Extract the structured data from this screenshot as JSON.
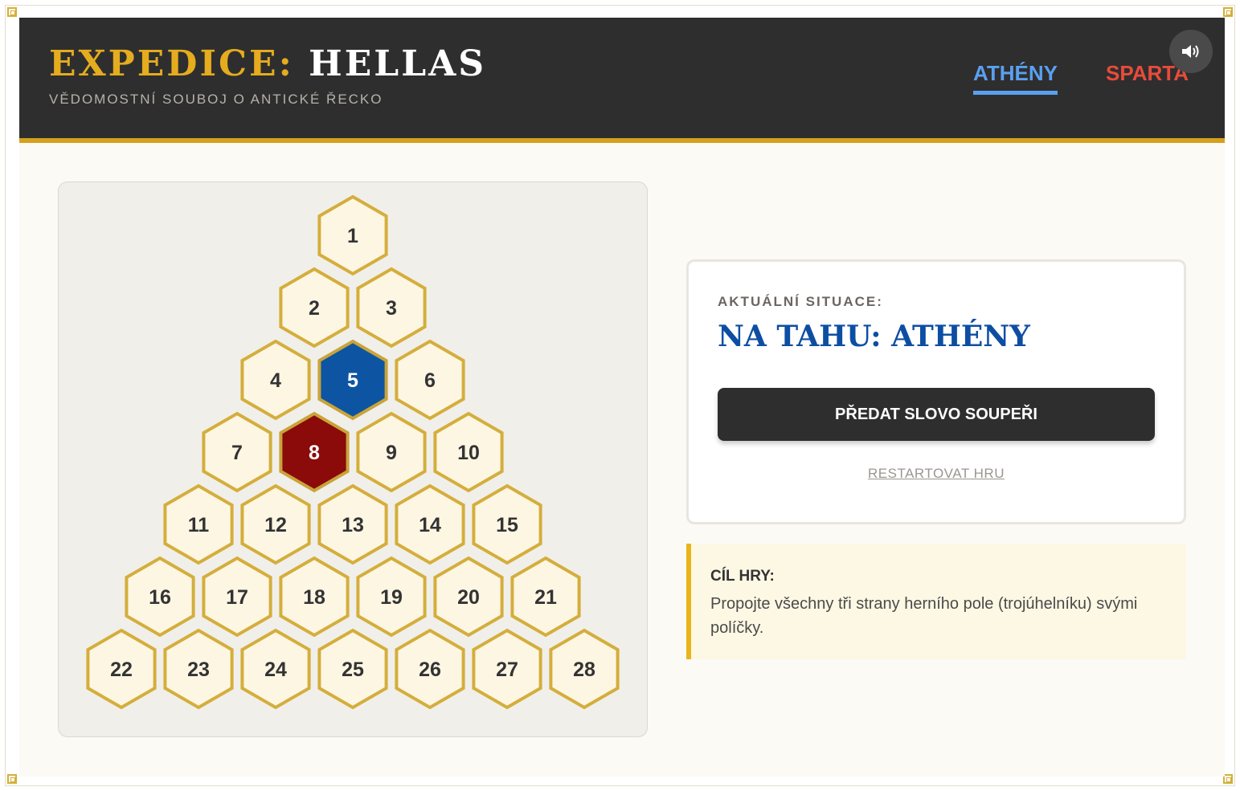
{
  "header": {
    "title_part1": "EXPEDICE:",
    "title_part2": "HELLAS",
    "subtitle": "VĚDOMOSTNÍ SOUBOJ O ANTICKÉ ŘECKO",
    "teams": [
      {
        "label": "ATHÉNY",
        "color": "#5aa0f0",
        "active": true
      },
      {
        "label": "SPARTA",
        "color": "#e84b3a",
        "active": false
      }
    ],
    "sound_icon": "speaker-icon"
  },
  "board": {
    "rows": 7,
    "cells": [
      {
        "n": "1",
        "owner": "none"
      },
      {
        "n": "2",
        "owner": "none"
      },
      {
        "n": "3",
        "owner": "none"
      },
      {
        "n": "4",
        "owner": "none"
      },
      {
        "n": "5",
        "owner": "athens"
      },
      {
        "n": "6",
        "owner": "none"
      },
      {
        "n": "7",
        "owner": "none"
      },
      {
        "n": "8",
        "owner": "sparta"
      },
      {
        "n": "9",
        "owner": "none"
      },
      {
        "n": "10",
        "owner": "none"
      },
      {
        "n": "11",
        "owner": "none"
      },
      {
        "n": "12",
        "owner": "none"
      },
      {
        "n": "13",
        "owner": "none"
      },
      {
        "n": "14",
        "owner": "none"
      },
      {
        "n": "15",
        "owner": "none"
      },
      {
        "n": "16",
        "owner": "none"
      },
      {
        "n": "17",
        "owner": "none"
      },
      {
        "n": "18",
        "owner": "none"
      },
      {
        "n": "19",
        "owner": "none"
      },
      {
        "n": "20",
        "owner": "none"
      },
      {
        "n": "21",
        "owner": "none"
      },
      {
        "n": "22",
        "owner": "none"
      },
      {
        "n": "23",
        "owner": "none"
      },
      {
        "n": "24",
        "owner": "none"
      },
      {
        "n": "25",
        "owner": "none"
      },
      {
        "n": "26",
        "owner": "none"
      },
      {
        "n": "27",
        "owner": "none"
      },
      {
        "n": "28",
        "owner": "none"
      }
    ],
    "colors": {
      "none_fill": "#fdf6e3",
      "none_stroke": "#d4ae3c",
      "none_text": "#333333",
      "athens_fill": "#0d55a3",
      "sparta_fill": "#8b0a0a",
      "owned_stroke": "#c9a43a",
      "owned_text": "#ffffff"
    }
  },
  "status": {
    "label": "AKTUÁLNÍ SITUACE:",
    "turn": "NA TAHU: ATHÉNY",
    "pass_button": "PŘEDAT SLOVO SOUPEŘI",
    "restart_link": "RESTARTOVAT HRU"
  },
  "goal": {
    "title": "CÍL HRY:",
    "text": "Propojte všechny tři strany herního pole (trojúhelníku) svými políčky."
  }
}
